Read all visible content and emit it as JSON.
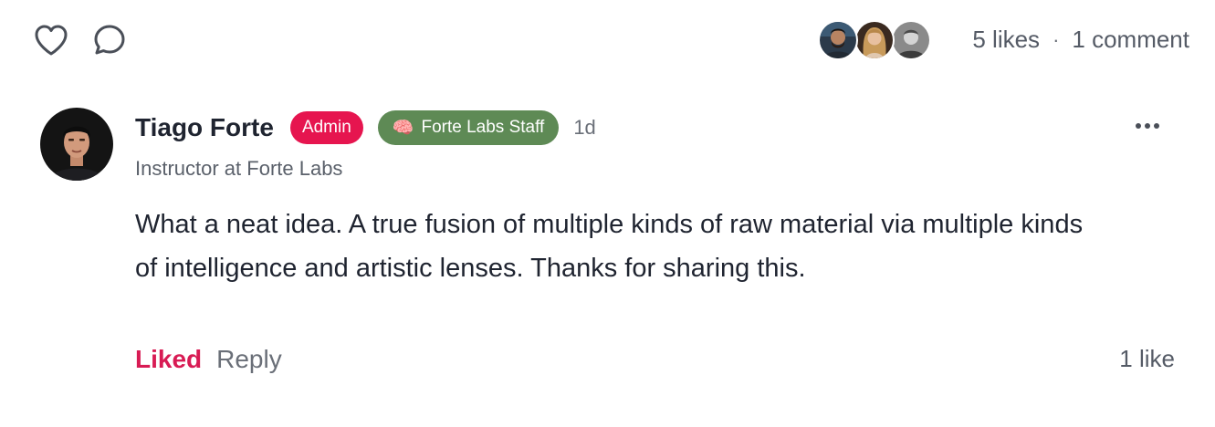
{
  "post_actions": {
    "like_icon": "heart-icon",
    "comment_icon": "comment-bubble-icon"
  },
  "engagement": {
    "likes_text": "5 likes",
    "separator": "·",
    "comments_text": "1 comment"
  },
  "comment": {
    "author": {
      "name": "Tiago Forte",
      "title": "Instructor at Forte Labs"
    },
    "badges": {
      "admin": "Admin",
      "staff_emoji": "🧠",
      "staff": "Forte Labs Staff"
    },
    "timestamp": "1d",
    "body": "What a neat idea. A true fusion of multiple kinds of raw material via multiple kinds of intelligence and artistic lenses. Thanks for sharing this.",
    "actions": {
      "liked_label": "Liked",
      "reply_label": "Reply"
    },
    "like_count": "1 like"
  },
  "colors": {
    "admin_badge": "#e6154f",
    "staff_badge": "#5e8a55",
    "liked": "#d81b54"
  }
}
